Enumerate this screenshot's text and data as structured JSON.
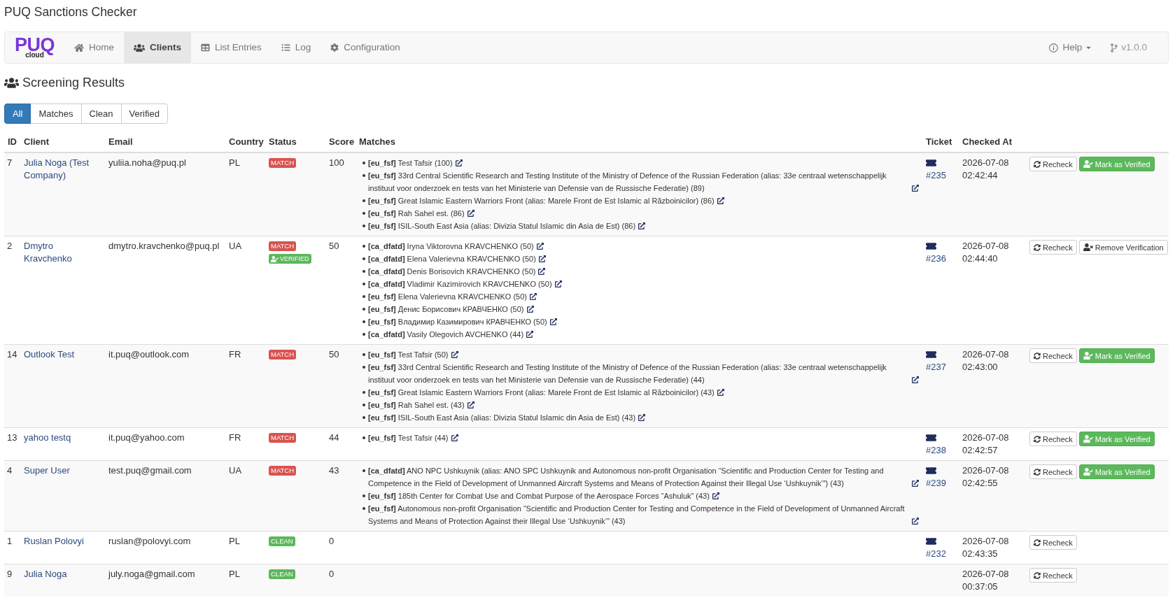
{
  "app_title": "PUQ Sanctions Checker",
  "navbar": {
    "logo": {
      "text": "PUQ",
      "subtext": "cloud"
    },
    "items": [
      {
        "label": "Home",
        "selected": false
      },
      {
        "label": "Clients",
        "selected": true
      },
      {
        "label": "List Entries",
        "selected": false
      },
      {
        "label": "Log",
        "selected": false
      },
      {
        "label": "Configuration",
        "selected": false
      }
    ],
    "right_items": [
      {
        "kind": "help",
        "label": "Help"
      },
      {
        "kind": "version",
        "label": "v1.0.0"
      }
    ]
  },
  "heading": "Screening Results",
  "filters": [
    {
      "label": "All",
      "selected": true
    },
    {
      "label": "Matches",
      "selected": false
    },
    {
      "label": "Clean",
      "selected": false
    },
    {
      "label": "Verified",
      "selected": false
    }
  ],
  "table": {
    "columns": [
      "ID",
      "Client",
      "Email",
      "Country",
      "Status",
      "Score",
      "Matches",
      "Ticket",
      "Checked At"
    ],
    "rows": [
      {
        "id": "7",
        "client": "Julia Noga (Test Company)",
        "email": "yuliia.noha@puq.pl",
        "country": "PL",
        "status": [
          {
            "kind": "match",
            "label": "MATCH"
          }
        ],
        "score": "100",
        "matches": [
          "**[eu_fsf]** Test Tafsir (100)",
          "**[eu_fsf]** 33rd Central Scientific Research and Testing Institute of the Ministry of Defence of the Russian Federation (alias: 33e centraal wetenschappelijk instituut voor onderzoek en tests van het Ministerie van Defensie van de Russische Federatie) (89)",
          "**[eu_fsf]** Great Islamic Eastern Warriors Front (alias: Marele Front de Est Islamic al Războinicilor) (86)",
          "**[eu_fsf]** Rah Sahel est. (86)",
          "**[eu_fsf]** ISIL-South East Asia (alias: Divizia Statul Islamic din Asia de Est) (86)"
        ],
        "ticket": "#235",
        "checked_at": "2026-07-08 02:42:44",
        "actions": [
          {
            "kind": "recheck",
            "label": "Recheck"
          },
          {
            "kind": "verify",
            "label": "Mark as Verified"
          }
        ]
      },
      {
        "id": "2",
        "client": "Dmytro Kravchenko",
        "email": "dmytro.kravchenko@puq.pl",
        "country": "UA",
        "status": [
          {
            "kind": "match",
            "label": "MATCH"
          },
          {
            "kind": "verified",
            "label": "VERIFIED"
          }
        ],
        "score": "50",
        "matches": [
          "**[ca_dfatd]** Iryna Viktorovna KRAVCHENKO (50)",
          "**[ca_dfatd]** Elena Valerievna KRAVCHENKO (50)",
          "**[ca_dfatd]** Denis Borisovich KRAVCHENKO (50)",
          "**[ca_dfatd]** Vladimir Kazimirovich KRAVCHENKO (50)",
          "**[eu_fsf]** Elena Valerievna KRAVCHENKO (50)",
          "**[eu_fsf]** Денис Борисович КРАВЧЕНКО (50)",
          "**[eu_fsf]** Владимир Казимирович КРАВЧЕНКО (50)",
          "**[ca_dfatd]** Vasily Olegovich AVCHENKO (44)"
        ],
        "ticket": "#236",
        "checked_at": "2026-07-08 02:44:40",
        "actions": [
          {
            "kind": "recheck",
            "label": "Recheck"
          },
          {
            "kind": "unverify",
            "label": "Remove Verification"
          }
        ]
      },
      {
        "id": "14",
        "client": "Outlook Test",
        "email": "it.puq@outlook.com",
        "country": "FR",
        "status": [
          {
            "kind": "match",
            "label": "MATCH"
          }
        ],
        "score": "50",
        "matches": [
          "**[eu_fsf]** Test Tafsir (50)",
          "**[eu_fsf]** 33rd Central Scientific Research and Testing Institute of the Ministry of Defence of the Russian Federation (alias: 33e centraal wetenschappelijk instituut voor onderzoek en tests van het Ministerie van Defensie van de Russische Federatie) (44)",
          "**[eu_fsf]** Great Islamic Eastern Warriors Front (alias: Marele Front de Est Islamic al Războinicilor) (43)",
          "**[eu_fsf]** Rah Sahel est. (43)",
          "**[eu_fsf]** ISIL-South East Asia (alias: Divizia Statul Islamic din Asia de Est) (43)"
        ],
        "ticket": "#237",
        "checked_at": "2026-07-08 02:43:00",
        "actions": [
          {
            "kind": "recheck",
            "label": "Recheck"
          },
          {
            "kind": "verify",
            "label": "Mark as Verified"
          }
        ]
      },
      {
        "id": "13",
        "client": "yahoo testq",
        "email": "it.puq@yahoo.com",
        "country": "FR",
        "status": [
          {
            "kind": "match",
            "label": "MATCH"
          }
        ],
        "score": "44",
        "matches": [
          "**[eu_fsf]** Test Tafsir (44)"
        ],
        "ticket": "#238",
        "checked_at": "2026-07-08 02:42:57",
        "actions": [
          {
            "kind": "recheck",
            "label": "Recheck"
          },
          {
            "kind": "verify",
            "label": "Mark as Verified"
          }
        ]
      },
      {
        "id": "4",
        "client": "Super User",
        "email": "test.puq@gmail.com",
        "country": "UA",
        "status": [
          {
            "kind": "match",
            "label": "MATCH"
          }
        ],
        "score": "43",
        "matches": [
          "**[ca_dfatd]** ANO NPC Ushkuynik (alias: ANO SPC Ushkuynik and Autonomous non-profit Organisation “Scientific and Production Center for Testing and Competence in the Field of Development of Unmanned Aircraft Systems and Means of Protection Against their Illegal Use ‘Ushkuynik’”) (43)",
          "**[eu_fsf]** 185th Center for Combat Use and Combat Purpose of the Aerospace Forces “Ashuluk” (43)",
          "**[eu_fsf]** Autonomous non-profit Organisation “Scientific and Production Center for Testing and Competence in the Field of Development of Unmanned Aircraft Systems and Means of Protection Against their Illegal Use ‘Ushkuynik’” (43)"
        ],
        "ticket": "#239",
        "checked_at": "2026-07-08 02:42:55",
        "actions": [
          {
            "kind": "recheck",
            "label": "Recheck"
          },
          {
            "kind": "verify",
            "label": "Mark as Verified"
          }
        ]
      },
      {
        "id": "1",
        "client": "Ruslan Polovyi",
        "email": "ruslan@polovyi.com",
        "country": "PL",
        "status": [
          {
            "kind": "clean",
            "label": "CLEAN"
          }
        ],
        "score": "0",
        "ticket": "#232",
        "checked_at": "2026-07-08 02:43:35",
        "actions": [
          {
            "kind": "recheck",
            "label": "Recheck"
          }
        ]
      },
      {
        "id": "9",
        "client": "Julia Noga",
        "email": "july.noga@gmail.com",
        "country": "PL",
        "status": [
          {
            "kind": "clean",
            "label": "CLEAN"
          }
        ],
        "score": "0",
        "checked_at": "2026-07-08 00:37:05",
        "actions": [
          {
            "kind": "recheck",
            "label": "Recheck"
          }
        ]
      }
    ]
  }
}
